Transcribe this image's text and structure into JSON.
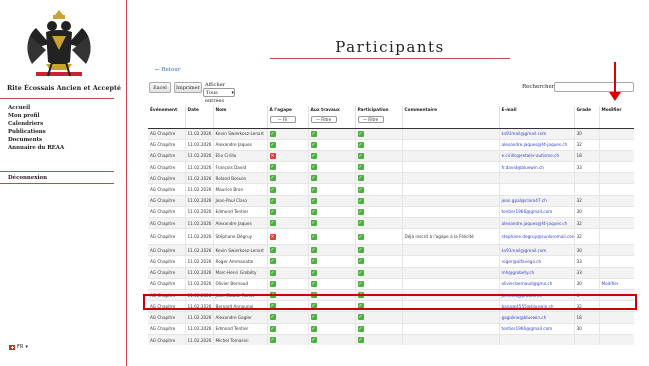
{
  "sidebar": {
    "brand": "Rite Écossais Ancien et Accepté",
    "nav": [
      "Accueil",
      "Mon profil",
      "Calendriers",
      "Publications",
      "Documents",
      "Annuaire du REAA"
    ],
    "logout": "Déconnexion",
    "language": "FR"
  },
  "page": {
    "title": "Participants",
    "back": "Retour",
    "buttons": {
      "excel": "Excel",
      "print": "Imprimer"
    },
    "show_label": "Afficher",
    "show_value": "Tous",
    "entries_label": "entrées",
    "search_label": "Rechercher :"
  },
  "table": {
    "headers": [
      "Événement",
      "Date",
      "Nom",
      "À l'agape",
      "Aux travaux",
      "Participation",
      "Commentaire",
      "E-mail",
      "Grade",
      "Modifier"
    ],
    "filters": {
      "agape": "— Fil",
      "travaux": "— Filtre",
      "participation": "— Filtre"
    },
    "rows": [
      {
        "event": "AG Chapitre",
        "date": "11.02.2026",
        "name": "Kevin Swierkosz-Lenart",
        "agape": true,
        "travaux": true,
        "part": true,
        "comment": "",
        "email": "ks91mail@gmail.com",
        "grade": "30",
        "modify": ""
      },
      {
        "event": "AG Chapitre",
        "date": "11.02.2026",
        "name": "Alexandre Jaques",
        "agape": true,
        "travaux": true,
        "part": true,
        "comment": "",
        "email": "alexandre.jaques@f4-jaques.ch",
        "grade": "32",
        "modify": ""
      },
      {
        "event": "AG Chapitre",
        "date": "11.02.2026",
        "name": "Elio Cirillo",
        "agape": false,
        "travaux": true,
        "part": true,
        "comment": "",
        "email": "e.cirillo@retaler-autisme.ch",
        "grade": "18",
        "modify": ""
      },
      {
        "event": "AG Chapitre",
        "date": "11.02.2026",
        "name": "François David",
        "agape": true,
        "travaux": true,
        "part": true,
        "comment": "",
        "email": "fr.david@bluewin.ch",
        "grade": "33",
        "modify": ""
      },
      {
        "event": "AG Chapitre",
        "date": "11.02.2026",
        "name": "Roland Bosson",
        "agape": true,
        "travaux": true,
        "part": true,
        "comment": "",
        "email": "",
        "grade": "",
        "modify": ""
      },
      {
        "event": "AG Chapitre",
        "date": "11.02.2026",
        "name": "Maurice Bron",
        "agape": true,
        "travaux": true,
        "part": true,
        "comment": "",
        "email": "",
        "grade": "",
        "modify": ""
      },
      {
        "event": "AG Chapitre",
        "date": "11.02.2026",
        "name": "Jean-Paul Claro",
        "agape": true,
        "travaux": true,
        "part": true,
        "comment": "",
        "email": "jean.gpal@claro47.ch",
        "grade": "32",
        "modify": ""
      },
      {
        "event": "AG Chapitre",
        "date": "11.02.2026",
        "name": "Edmond Tentier",
        "agape": true,
        "travaux": true,
        "part": true,
        "comment": "",
        "email": "tentier1966@gmail.com",
        "grade": "30",
        "modify": ""
      },
      {
        "event": "AG Chapitre",
        "date": "11.02.2026",
        "name": "Alexandre Jaques",
        "agape": true,
        "travaux": true,
        "part": true,
        "comment": "",
        "email": "alexandre.jaques@f4-jaques.ch",
        "grade": "32",
        "modify": ""
      },
      {
        "event": "AG Chapitre",
        "date": "11.02.2026",
        "name": "Stéphane Dégruy",
        "agape": false,
        "travaux": true,
        "part": true,
        "comment": "Déjà inscrit à l'agape à la Félicité",
        "email": "stephane.degruy@sunloromail.com",
        "grade": "32",
        "modify": "",
        "tall": true
      },
      {
        "event": "AG Chapitre",
        "date": "11.02.2026",
        "name": "Kevin Swierkosz-Lenart",
        "agape": true,
        "travaux": true,
        "part": true,
        "comment": "",
        "email": "ks91mail@gmail.com",
        "grade": "30",
        "modify": ""
      },
      {
        "event": "AG Chapitre",
        "date": "11.02.2026",
        "name": "Roger Ammanatie",
        "agape": true,
        "travaux": true,
        "part": true,
        "comment": "",
        "email": "roger@alfavega.ch",
        "grade": "33",
        "modify": ""
      },
      {
        "event": "AG Chapitre",
        "date": "11.02.2026",
        "name": "Marc-Henri Grobéty",
        "agape": true,
        "travaux": true,
        "part": true,
        "comment": "",
        "email": "mh@grobety.ch",
        "grade": "33",
        "modify": ""
      },
      {
        "event": "AG Chapitre",
        "date": "11.02.2026",
        "name": "Olivier Bernaud",
        "agape": true,
        "travaux": true,
        "part": true,
        "comment": "",
        "email": "olivier.bernaud@gmx.ch",
        "grade": "30",
        "modify": "Modifier",
        "highlight": true
      },
      {
        "event": "AG Chapitre",
        "date": "11.02.2026",
        "name": "Jean-Claude Renet",
        "agape": true,
        "travaux": true,
        "part": true,
        "comment": "",
        "email": "jc.renet@protonme",
        "grade": "4",
        "modify": ""
      },
      {
        "event": "AG Chapitre",
        "date": "11.02.2026",
        "name": "Bernard Annaunai",
        "agape": true,
        "travaux": true,
        "part": true,
        "comment": "",
        "email": "bana@4555@bluewin.ch",
        "grade": "32",
        "modify": ""
      },
      {
        "event": "AG Chapitre",
        "date": "11.02.2026",
        "name": "Alexandre Gagler",
        "agape": true,
        "travaux": true,
        "part": true,
        "comment": "",
        "email": "gagaline@bluewin.ch",
        "grade": "18",
        "modify": ""
      },
      {
        "event": "AG Chapitre",
        "date": "11.02.2026",
        "name": "Edmond Tentier",
        "agape": true,
        "travaux": true,
        "part": true,
        "comment": "",
        "email": "tentier1966@gmail.com",
        "grade": "30",
        "modify": ""
      },
      {
        "event": "AG Chapitre",
        "date": "11.02.2026",
        "name": "Michel Tomasini",
        "agape": true,
        "travaux": true,
        "part": true,
        "comment": "",
        "email": "",
        "grade": "",
        "modify": ""
      }
    ]
  }
}
